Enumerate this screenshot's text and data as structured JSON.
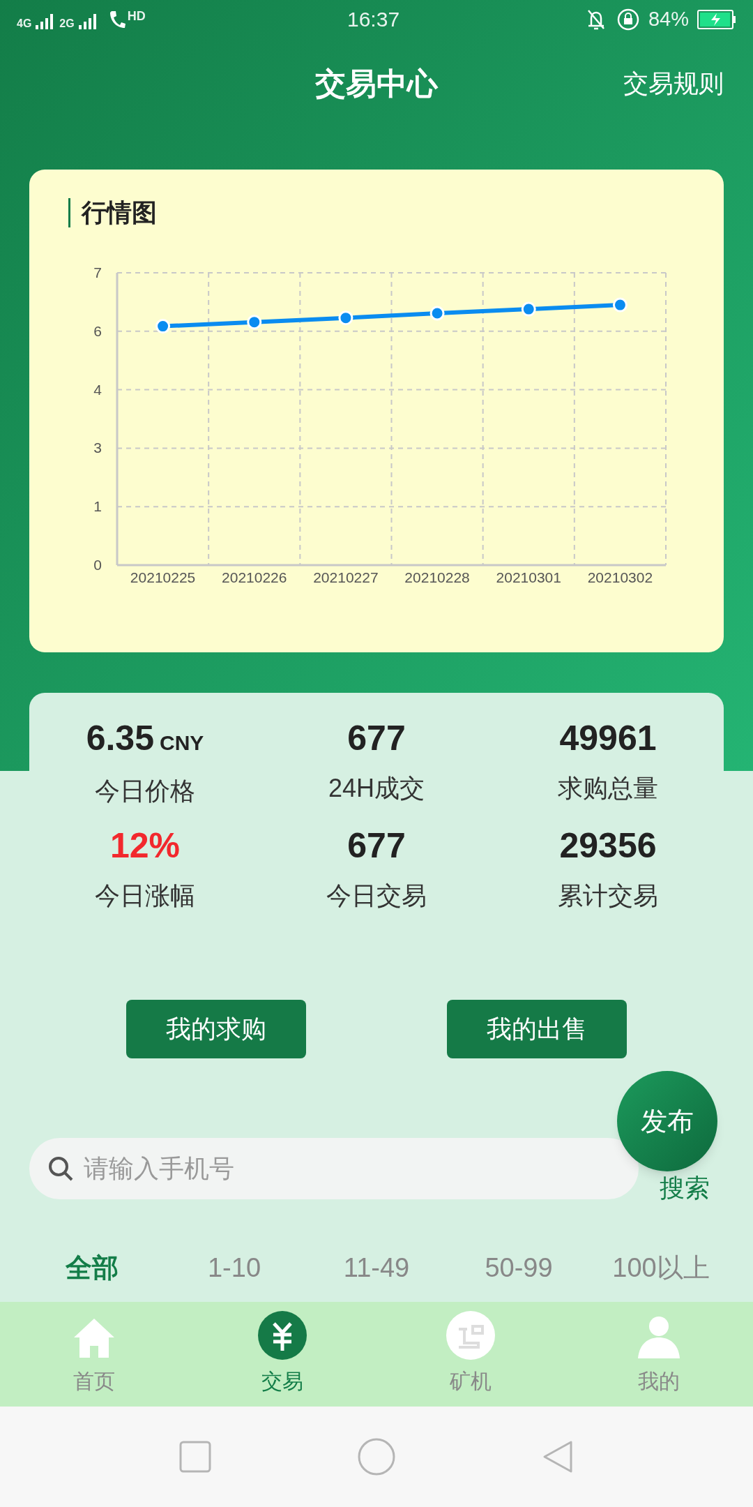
{
  "status_bar": {
    "network_1": "4G",
    "network_2": "2G",
    "call": "HD",
    "time": "16:37",
    "battery": "84%"
  },
  "header": {
    "title": "交易中心",
    "action": "交易规则"
  },
  "chart_card": {
    "title": "行情图",
    "chart_data": {
      "type": "line",
      "categories": [
        "20210225",
        "20210226",
        "20210227",
        "20210228",
        "20210301",
        "20210302"
      ],
      "series": [
        {
          "color": "#0a8cf0",
          "marker": true,
          "values": [
            5.72,
            5.82,
            5.92,
            6.03,
            6.13,
            6.23
          ]
        }
      ],
      "grid": true,
      "ylim": [
        0,
        7
      ],
      "yticks": [
        {
          "value": 0,
          "label": "0"
        },
        {
          "value": 1.4,
          "label": "1"
        },
        {
          "value": 2.8,
          "label": "3"
        },
        {
          "value": 4.2,
          "label": "4"
        },
        {
          "value": 5.6,
          "label": "6"
        },
        {
          "value": 7,
          "label": "7"
        }
      ]
    }
  },
  "stats": [
    {
      "value": "6.35",
      "unit": "CNY",
      "label": "今日价格",
      "highlight": false
    },
    {
      "value": "677",
      "label": "24H成交",
      "highlight": false
    },
    {
      "value": "49961",
      "label": "求购总量",
      "highlight": false
    },
    {
      "value": "12%",
      "label": "今日涨幅",
      "highlight": true
    },
    {
      "value": "677",
      "label": "今日交易",
      "highlight": false
    },
    {
      "value": "29356",
      "label": "累计交易",
      "highlight": false
    }
  ],
  "buttons": [
    "我的求购",
    "我的出售"
  ],
  "publish_button": "发布",
  "search": {
    "placeholder": "请输入手机号",
    "button": "搜索"
  },
  "filter_tabs": [
    {
      "label": "全部",
      "selected": true
    },
    {
      "label": "1-10",
      "selected": false
    },
    {
      "label": "11-49",
      "selected": false
    },
    {
      "label": "50-99",
      "selected": false
    },
    {
      "label": "100以上",
      "selected": false
    }
  ],
  "bottom_nav": [
    {
      "label": "首页",
      "kind": "home",
      "selected": false
    },
    {
      "label": "交易",
      "kind": "trade",
      "selected": true
    },
    {
      "label": "矿机",
      "kind": "miner",
      "selected": false
    },
    {
      "label": "我的",
      "kind": "profile",
      "selected": false
    }
  ]
}
